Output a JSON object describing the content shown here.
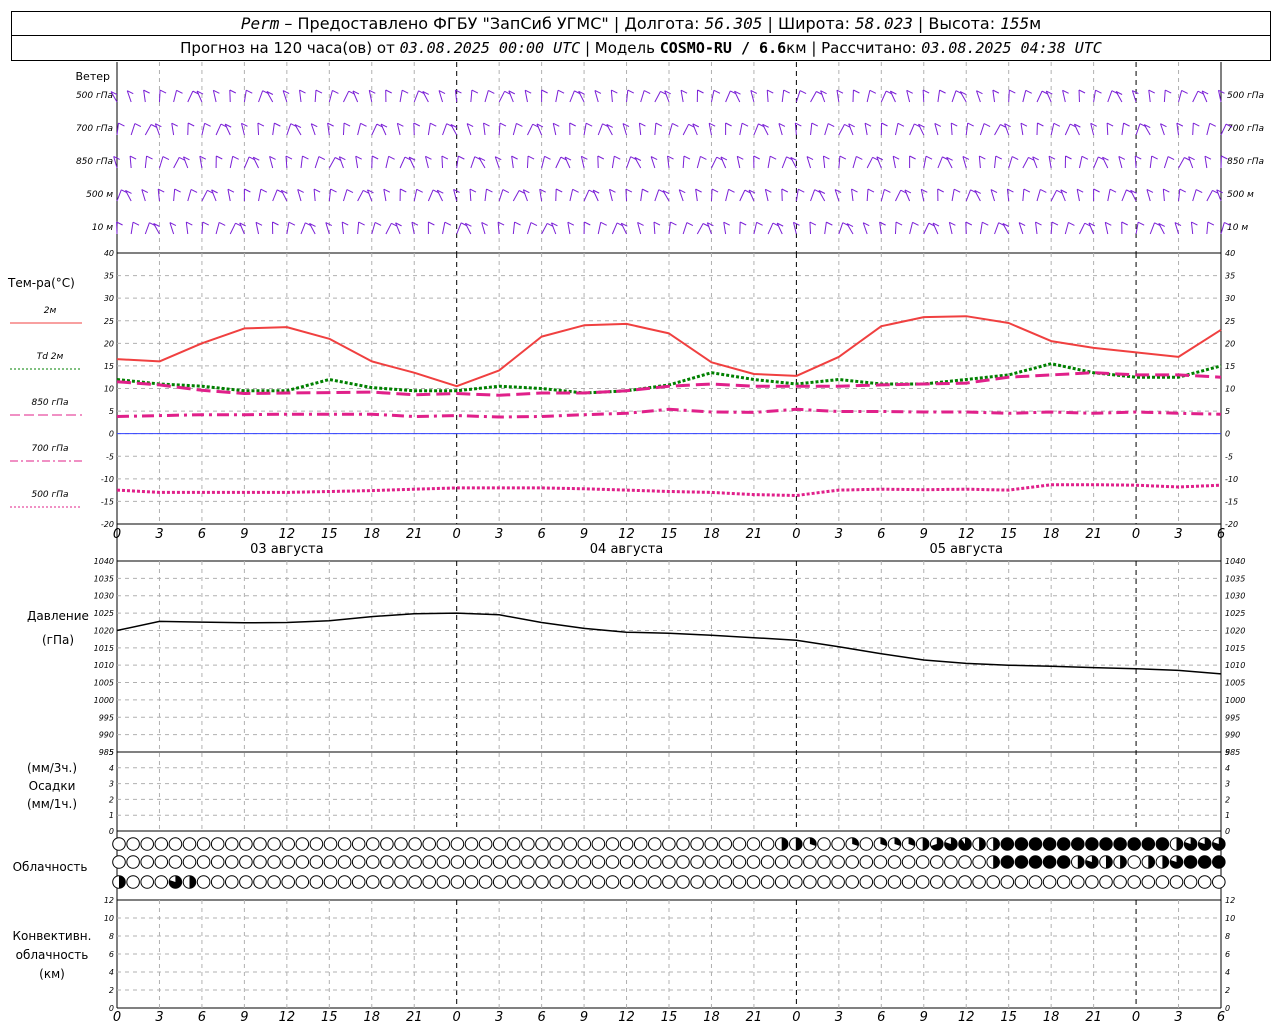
{
  "header": {
    "station": "Perm",
    "dash": " – ",
    "provider": "Предоставлено ФГБУ \"ЗапСиб УГМС\"",
    "sep": " | ",
    "lon_label": "Долгота: ",
    "lon": "56.305",
    "lat_label": "Широта: ",
    "lat": "58.023",
    "alt_label": "Высота: ",
    "alt": "155",
    "alt_unit": "м",
    "forecast_label": "Прогноз на 120 часа(ов) от ",
    "forecast_time": "03.08.2025 00:00 UTC",
    "model_label": "Модель ",
    "model": "COSMO-RU / 6.6",
    "model_unit": "км",
    "calc_label": "Рассчитано: ",
    "calc_time": "03.08.2025 04:38 UTC"
  },
  "panels": {
    "wind": {
      "title": "Ветер",
      "levels": [
        "500 гПа",
        "700 гПа",
        "850 гПа",
        "500 м",
        "10  м"
      ],
      "color": "#7a1fd6"
    },
    "temperature": {
      "title": "Тем-ра(°С)",
      "legend": [
        {
          "label": "2м",
          "color": "#f04040",
          "dash": "solid"
        },
        {
          "label": "Td  2м",
          "color": "#008000",
          "dash": "dotted"
        },
        {
          "label": "850 гПа",
          "color": "#e0208a",
          "dash": "long-dash"
        },
        {
          "label": "700 гПа",
          "color": "#e0208a",
          "dash": "dash-dot"
        },
        {
          "label": "500 гПа",
          "color": "#e0208a",
          "dash": "dotted"
        }
      ],
      "yticks": [
        "40",
        "35",
        "30",
        "25",
        "20",
        "15",
        "10",
        "5",
        "0",
        "-5",
        "-10",
        "-15",
        "-20"
      ],
      "dates": [
        "03 августа",
        "04 августа",
        "05 августа"
      ]
    },
    "pressure": {
      "title": "Давление",
      "unit": "(гПа)",
      "yticks": [
        "1040",
        "1035",
        "1030",
        "1025",
        "1020",
        "1015",
        "1010",
        "1005",
        "1000",
        "995",
        "990",
        "985"
      ]
    },
    "precip": {
      "unit_top": "(мм/3ч.)",
      "title": "Осадки",
      "unit_bottom": "(мм/1ч.)",
      "yticks": [
        "5",
        "4",
        "3",
        "2",
        "1",
        "0"
      ]
    },
    "cloud": {
      "title": "Облачность"
    },
    "convective": {
      "title_1": "Конвективн.",
      "title_2": "облачность",
      "unit": "(км)",
      "yticks": [
        "12",
        "10",
        "8",
        "6",
        "4",
        "2",
        "0"
      ]
    }
  },
  "xaxis": {
    "ticks": [
      "0",
      "3",
      "6",
      "9",
      "12",
      "15",
      "18",
      "21",
      "0",
      "3",
      "6",
      "9",
      "12",
      "15",
      "18",
      "21",
      "0",
      "3",
      "6",
      "9",
      "12",
      "15",
      "18",
      "21",
      "0",
      "3",
      "6"
    ]
  },
  "chart_data": [
    {
      "type": "line",
      "title": "Тем-ра(°С)",
      "x_hours": [
        0,
        3,
        6,
        9,
        12,
        15,
        18,
        21,
        24,
        27,
        30,
        33,
        36,
        39,
        42,
        45,
        48,
        51,
        54,
        57,
        60,
        63,
        66,
        69,
        72,
        75,
        78
      ],
      "ylim": [
        -20,
        40
      ],
      "series": [
        {
          "name": "2м",
          "values": [
            16.5,
            16,
            20,
            23.3,
            23.6,
            21,
            16,
            13.5,
            10.5,
            14,
            21.5,
            24,
            24.3,
            22.2,
            15.8,
            13.2,
            12.8,
            17,
            23.8,
            25.8,
            26,
            24.5,
            20.5,
            19,
            18,
            17,
            23
          ]
        },
        {
          "name": "Td  2м",
          "values": [
            12,
            11,
            10.5,
            9.5,
            9.5,
            12,
            10.2,
            9.5,
            9.5,
            10.5,
            10,
            9,
            9.5,
            10.8,
            13.5,
            12,
            11,
            12,
            11,
            11,
            12,
            13,
            15.5,
            13.5,
            12.5,
            12.5,
            15
          ]
        },
        {
          "name": "850 гПа",
          "values": [
            11.5,
            10.8,
            9.6,
            8.9,
            9,
            9.1,
            9.2,
            8.6,
            8.9,
            8.5,
            9,
            9,
            9.5,
            10.5,
            11,
            10.5,
            10.5,
            10.5,
            10.8,
            11,
            11.2,
            12.5,
            13,
            13.5,
            13,
            13,
            12.5
          ]
        },
        {
          "name": "700 гПа",
          "values": [
            3.8,
            4,
            4.2,
            4.2,
            4.3,
            4.3,
            4.3,
            3.8,
            4,
            3.7,
            3.8,
            4.2,
            4.5,
            5.4,
            4.8,
            4.7,
            5.4,
            4.9,
            4.9,
            4.8,
            4.8,
            4.5,
            4.8,
            4.5,
            4.8,
            4.5,
            4.3
          ]
        },
        {
          "name": "500 гПа",
          "values": [
            -12.5,
            -13,
            -13,
            -13,
            -13,
            -12.8,
            -12.6,
            -12.3,
            -12,
            -12,
            -12,
            -12.2,
            -12.5,
            -12.8,
            -13,
            -13.5,
            -13.7,
            -12.5,
            -12.3,
            -12.4,
            -12.3,
            -12.5,
            -11.3,
            -11.3,
            -11.4,
            -11.8,
            -11.4
          ]
        }
      ]
    },
    {
      "type": "line",
      "title": "Давление",
      "x_hours": [
        0,
        3,
        6,
        9,
        12,
        15,
        18,
        21,
        24,
        27,
        30,
        33,
        36,
        39,
        42,
        45,
        48,
        51,
        54,
        57,
        60,
        63,
        66,
        69,
        72,
        75,
        78
      ],
      "ylim": [
        985,
        1040
      ],
      "series": [
        {
          "values": [
            1020,
            1022.6,
            1022.4,
            1022.2,
            1022.3,
            1022.8,
            1024,
            1024.8,
            1025,
            1024.5,
            1022.3,
            1020.6,
            1019.5,
            1019.2,
            1018.6,
            1017.9,
            1017.2,
            1015.3,
            1013.3,
            1011.5,
            1010.5,
            1010,
            1009.7,
            1009.3,
            1009,
            1008.5,
            1007.5
          ]
        }
      ]
    },
    {
      "type": "bar",
      "title": "Осадки",
      "ylim": [
        0,
        5
      ],
      "x_hours": [
        0,
        78
      ],
      "values": [
        0,
        0
      ]
    },
    {
      "type": "heatmap",
      "title": "Облачность",
      "x_hours": [
        0,
        1,
        2,
        3,
        4,
        5,
        6,
        7,
        8,
        9,
        10,
        11,
        12,
        13,
        14,
        15,
        16,
        17,
        18,
        19,
        20,
        21,
        22,
        23,
        24,
        25,
        26,
        27,
        28,
        29,
        30,
        31,
        32,
        33,
        34,
        35,
        36,
        37,
        38,
        39,
        40,
        41,
        42,
        43,
        44,
        45,
        46,
        47,
        48,
        49,
        50,
        51,
        52,
        53,
        54,
        55,
        56,
        57,
        58,
        59,
        60,
        61,
        62,
        63,
        64,
        65,
        66,
        67,
        68,
        69,
        70,
        71,
        72,
        73,
        74,
        75,
        76,
        77,
        78
      ],
      "rows": [
        {
          "level": "upper",
          "values": [
            0,
            0,
            0,
            0,
            0,
            0,
            0,
            0,
            0,
            0,
            0,
            0,
            0,
            0,
            0,
            0,
            0,
            0,
            0,
            0,
            0,
            0,
            0,
            0,
            0,
            0,
            0,
            0,
            0,
            0,
            0,
            0,
            0,
            0,
            0,
            0,
            0,
            0,
            0,
            0,
            0,
            0,
            0,
            0,
            0,
            0,
            0,
            0,
            0,
            0,
            0,
            0,
            0,
            0,
            0,
            0,
            0,
            0,
            0,
            0,
            0,
            0,
            0,
            0,
            0,
            0,
            0,
            0,
            0,
            0,
            0,
            0,
            0,
            0,
            0,
            0,
            0,
            0,
            0,
            0,
            0,
            0,
            0,
            0,
            0,
            0,
            0,
            0,
            0,
            0,
            0,
            0,
            0,
            0,
            0,
            0,
            0,
            0,
            0,
            0,
            0,
            0,
            0,
            0,
            0,
            0,
            0,
            0,
            0,
            0
          ]
        },
        {
          "level": "middle",
          "values": [
            0,
            0,
            0,
            0,
            0,
            0,
            0,
            0,
            0,
            0,
            0,
            0,
            0,
            0,
            0,
            0,
            0,
            0,
            0,
            0,
            0,
            0,
            0,
            0,
            0,
            0,
            0,
            0,
            0,
            0,
            0,
            0,
            0,
            0,
            0,
            0,
            0,
            0,
            0,
            0,
            0,
            0,
            0,
            0,
            0,
            0,
            0,
            0,
            0,
            0,
            0,
            0,
            0,
            0,
            0,
            0,
            0,
            0,
            0,
            0,
            0,
            0,
            0,
            0,
            0,
            0,
            0,
            0,
            0,
            0,
            0,
            0,
            0,
            0,
            0,
            0,
            0,
            0,
            0,
            0,
            0,
            0,
            0,
            0,
            0,
            0,
            0,
            0,
            0,
            0,
            0,
            0,
            0,
            0,
            0,
            0,
            0,
            0,
            0,
            0,
            0,
            0,
            0,
            0,
            0,
            0,
            0,
            0,
            0,
            0
          ]
        },
        {
          "level": "lower",
          "values": [
            0,
            0,
            0,
            0,
            0,
            0,
            0,
            0,
            0,
            0,
            0,
            0,
            0,
            0,
            0,
            0,
            0,
            0,
            0,
            0,
            0,
            0,
            0,
            0,
            0,
            0,
            0,
            0,
            0,
            0,
            0,
            0,
            0,
            0,
            0,
            0,
            0,
            0,
            0,
            0,
            0,
            0,
            0,
            0,
            0,
            0,
            0,
            0,
            0,
            0,
            0,
            0,
            0,
            0,
            0,
            0,
            0,
            0,
            0,
            0,
            0,
            0,
            0,
            0,
            0,
            0,
            0,
            0,
            0,
            0,
            0,
            0,
            0,
            0,
            0,
            0,
            0,
            0,
            0,
            0,
            0,
            0,
            0,
            0,
            0,
            0,
            0,
            0,
            0,
            0,
            0,
            0,
            0,
            0,
            0,
            0,
            0,
            0,
            0,
            0,
            0,
            0,
            0,
            0,
            0,
            0,
            0,
            0,
            0,
            0
          ]
        }
      ],
      "upper_fill": [
        0,
        0,
        0,
        0,
        0,
        0,
        0,
        0,
        0,
        0,
        0,
        0,
        0,
        0,
        0,
        0,
        0,
        0,
        0,
        0,
        0,
        0,
        0,
        0,
        0,
        0,
        0,
        0,
        0,
        0,
        0,
        0,
        0,
        0,
        0,
        0,
        0,
        0,
        0,
        0,
        0,
        0,
        0,
        0,
        0,
        0,
        0,
        0.5,
        0.5,
        0.3,
        0,
        0,
        0.3,
        0,
        0.3,
        0.3,
        0.3,
        0.5,
        0.7,
        0.8,
        0.9,
        0.5,
        0.5,
        1,
        1,
        1,
        1,
        1,
        1,
        1,
        1,
        1,
        1,
        1,
        1,
        0.5,
        0.8,
        0.8,
        0.8,
        0.5
      ],
      "middle_fill": [
        0,
        0,
        0,
        0,
        0,
        0,
        0,
        0,
        0,
        0,
        0,
        0,
        0,
        0,
        0,
        0,
        0,
        0,
        0,
        0,
        0,
        0,
        0,
        0,
        0,
        0,
        0,
        0,
        0,
        0,
        0,
        0,
        0,
        0,
        0,
        0,
        0,
        0,
        0,
        0,
        0,
        0,
        0,
        0,
        0,
        0,
        0,
        0,
        0,
        0,
        0,
        0,
        0,
        0,
        0,
        0,
        0,
        0,
        0,
        0,
        0,
        0,
        0.5,
        1,
        1,
        1,
        1,
        1,
        0.5,
        0.8,
        0.5,
        0.5,
        0,
        0.5,
        0.5,
        0.8,
        1,
        1,
        1,
        1
      ],
      "lower_fill": [
        0.5,
        0,
        0,
        0,
        0.8,
        0.5,
        0,
        0,
        0,
        0,
        0,
        0,
        0,
        0,
        0,
        0,
        0,
        0,
        0,
        0,
        0,
        0,
        0,
        0,
        0,
        0,
        0,
        0,
        0,
        0,
        0,
        0,
        0,
        0,
        0,
        0,
        0,
        0,
        0,
        0,
        0,
        0,
        0,
        0,
        0,
        0,
        0,
        0,
        0,
        0,
        0,
        0,
        0,
        0,
        0,
        0,
        0,
        0,
        0,
        0,
        0,
        0,
        0,
        0,
        0,
        0,
        0,
        0,
        0,
        0,
        0,
        0,
        0,
        0,
        0,
        0,
        0,
        0,
        0,
        0
      ]
    },
    {
      "type": "bar",
      "title": "Конвективн. облачность",
      "ylim": [
        0,
        12
      ],
      "x_hours": [
        0,
        78
      ],
      "values": [
        0,
        0
      ]
    }
  ]
}
